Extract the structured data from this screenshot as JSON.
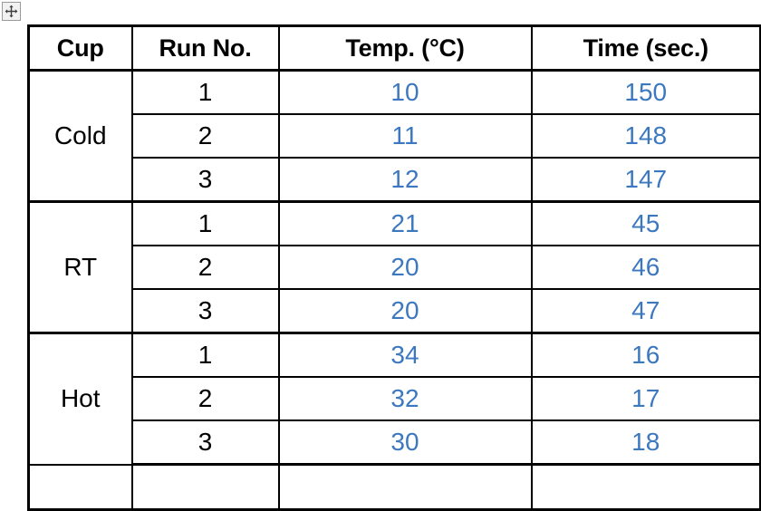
{
  "toolbar": {
    "move_handle_icon": "move-cross-icon",
    "move_handle_label": "Move table"
  },
  "table": {
    "columns": [
      "Cup",
      "Run No.",
      "Temp. (°C)",
      "Time (sec.)"
    ],
    "value_color": "#3c78c0",
    "text_color": "#000000",
    "border_color": "#000000",
    "groups": [
      {
        "cup": "Cold",
        "rows": [
          {
            "run": "1",
            "temp": "10",
            "time": "150"
          },
          {
            "run": "2",
            "temp": "11",
            "time": "148"
          },
          {
            "run": "3",
            "temp": "12",
            "time": "147"
          }
        ]
      },
      {
        "cup": "RT",
        "rows": [
          {
            "run": "1",
            "temp": "21",
            "time": "45"
          },
          {
            "run": "2",
            "temp": "20",
            "time": "46"
          },
          {
            "run": "3",
            "temp": "20",
            "time": "47"
          }
        ]
      },
      {
        "cup": "Hot",
        "rows": [
          {
            "run": "1",
            "temp": "34",
            "time": "16"
          },
          {
            "run": "2",
            "temp": "32",
            "time": "17"
          },
          {
            "run": "3",
            "temp": "30",
            "time": "18"
          }
        ]
      }
    ],
    "blank_row": {
      "cup": "",
      "run": "",
      "temp": "",
      "time": ""
    }
  }
}
